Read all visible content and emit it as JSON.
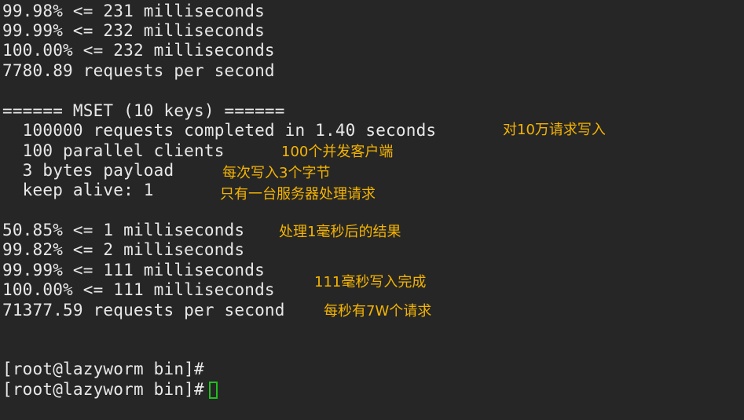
{
  "terminal": {
    "lines": [
      "99.98% <= 231 milliseconds",
      "99.99% <= 232 milliseconds",
      "100.00% <= 232 milliseconds",
      "7780.89 requests per second",
      "",
      "====== MSET (10 keys) ======",
      "  100000 requests completed in 1.40 seconds",
      "  100 parallel clients",
      "  3 bytes payload",
      "  keep alive: 1",
      "",
      "50.85% <= 1 milliseconds",
      "99.82% <= 2 milliseconds",
      "99.99% <= 111 milliseconds",
      "100.00% <= 111 milliseconds",
      "71377.59 requests per second",
      "",
      "",
      "[root@lazyworm bin]#",
      "[root@lazyworm bin]#"
    ]
  },
  "annotations": {
    "requests_total": "对10万请求写入",
    "parallel_clients": "100个并发客户端",
    "payload": "每次写入3个字节",
    "keep_alive": "只有一台服务器处理请求",
    "first_ms": "处理1毫秒后的结果",
    "complete": "111毫秒写入完成",
    "rps": "每秒有7W个请求"
  },
  "colors": {
    "background": "#262626",
    "text": "#e8e8e8",
    "annotation": "#f5b400",
    "cursor": "#1fbf1f"
  }
}
